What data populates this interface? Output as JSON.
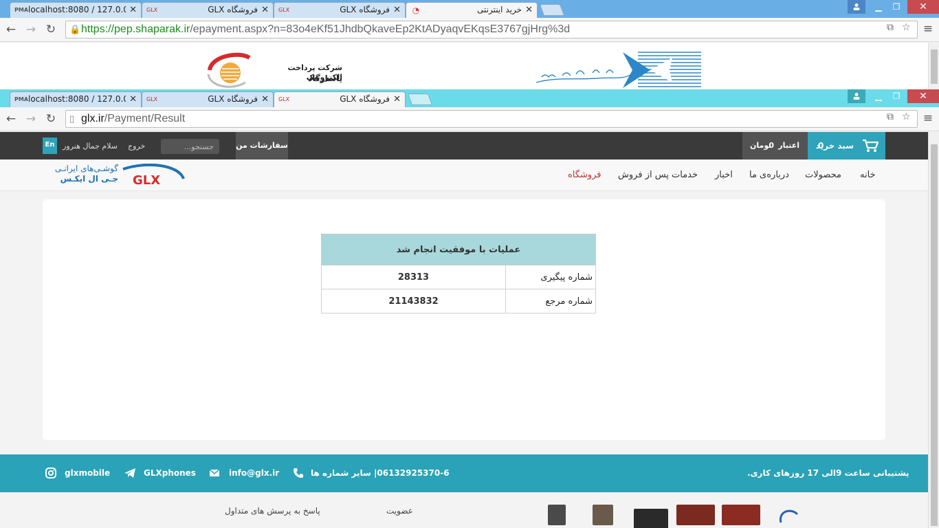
{
  "outer_browser": {
    "tabs": [
      {
        "label": "localhost:8080 / 127.0.0.1",
        "icon": "phpmyadmin-icon"
      },
      {
        "label": "فروشگاه GLX",
        "icon": "glx-favicon"
      },
      {
        "label": "فروشگاه GLX",
        "icon": "glx-favicon"
      },
      {
        "label": "خرید اینترنتی",
        "icon": "shaparak-favicon"
      }
    ],
    "url_secure": "https://",
    "url_host": "pep.shaparak.ir",
    "url_rest": "/epayment.aspx?n=83o4eKf51JhdbQkaveEp2KtADyaqvEKqsE3767gjHrg%3d"
  },
  "bank_page": {
    "company_name": "شرکت پرداخت الکترونیک",
    "company_brand": "پاسارگاد"
  },
  "inner_browser": {
    "tabs": [
      {
        "label": "localhost:8080 / 127.0.0.1",
        "icon": "phpmyadmin-icon"
      },
      {
        "label": "فروشگاه GLX",
        "icon": "glx-favicon"
      },
      {
        "label": "فروشگاه GLX",
        "icon": "glx-favicon"
      }
    ],
    "url_host": "glx.ir",
    "url_rest": "/Payment/Result"
  },
  "topnav": {
    "cart_label": "سبد خرید",
    "cart_count": "0",
    "credit_label": "اعتبار",
    "credit_value": "0",
    "credit_unit": "تومان",
    "my_orders": "سفارشات من",
    "search_placeholder": "جستجو...",
    "logout": "خروج",
    "greeting": "سلام  جمال هنرور",
    "lang": "En"
  },
  "mainnav": {
    "items": [
      "خانه",
      "محصولات",
      "درباره‌ی ما",
      "اخبار",
      "خدمات پس از فروش",
      "فروشگاه"
    ],
    "logo_fa_line1": "گوشـی‌های ایرانـی",
    "logo_fa_line2": "جـی ال ایکـس",
    "logo_text": "GLX"
  },
  "result": {
    "title": "عملیات با موفقیت انجام شد",
    "rows": [
      {
        "label": "شماره پیگیری",
        "value": "28313"
      },
      {
        "label": "شماره مرجع",
        "value": "21143832"
      }
    ]
  },
  "footer": {
    "support": "پشتیبانی ساعت 9الی 17 روزهای کاری.",
    "phone": "06132925370-6| سایر شماره ها",
    "email": "info@glx.ir",
    "telegram": "GLXphones",
    "instagram": "glxmobile",
    "links": [
      "عضویت",
      "پاسخ به پرسش های متداول"
    ]
  },
  "colors": {
    "accent": "#2ea3b9",
    "header_dark": "#3a3a3a",
    "active_menu": "#c22f2f",
    "table_header": "#a8d8dc"
  }
}
